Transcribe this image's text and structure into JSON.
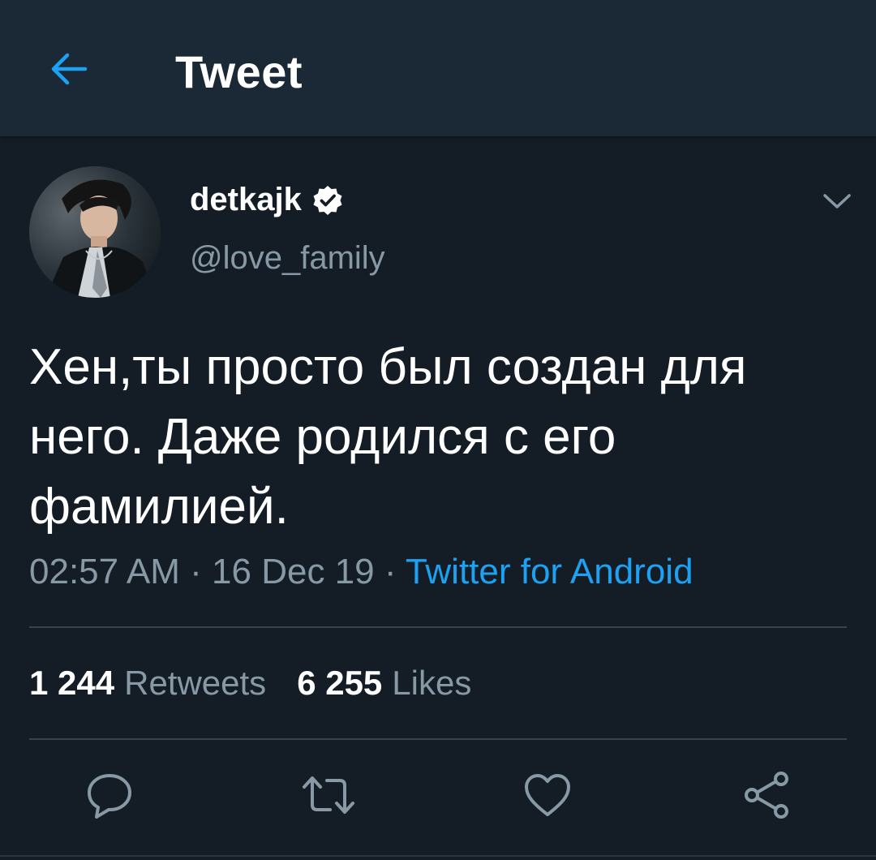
{
  "header": {
    "title": "Tweet",
    "back_icon": "arrow-left-icon"
  },
  "tweet": {
    "author": {
      "display_name": "detkajk",
      "handle": "@love_family",
      "verified": true
    },
    "text": "Хен,ты просто был создан для него. Даже родился с его фамилией.",
    "time": "02:57 AM",
    "date": "16 Dec 19",
    "separator": "·",
    "source": "Twitter for Android"
  },
  "stats": {
    "retweets_count": "1 244",
    "retweets_label": "Retweets",
    "likes_count": "6 255",
    "likes_label": "Likes"
  },
  "actions": [
    "reply-icon",
    "retweet-icon",
    "like-icon",
    "share-icon"
  ],
  "colors": {
    "background": "#141d26",
    "header": "#1b2836",
    "accent": "#1da1f2",
    "muted": "#8899a6",
    "divider": "#38444d"
  }
}
